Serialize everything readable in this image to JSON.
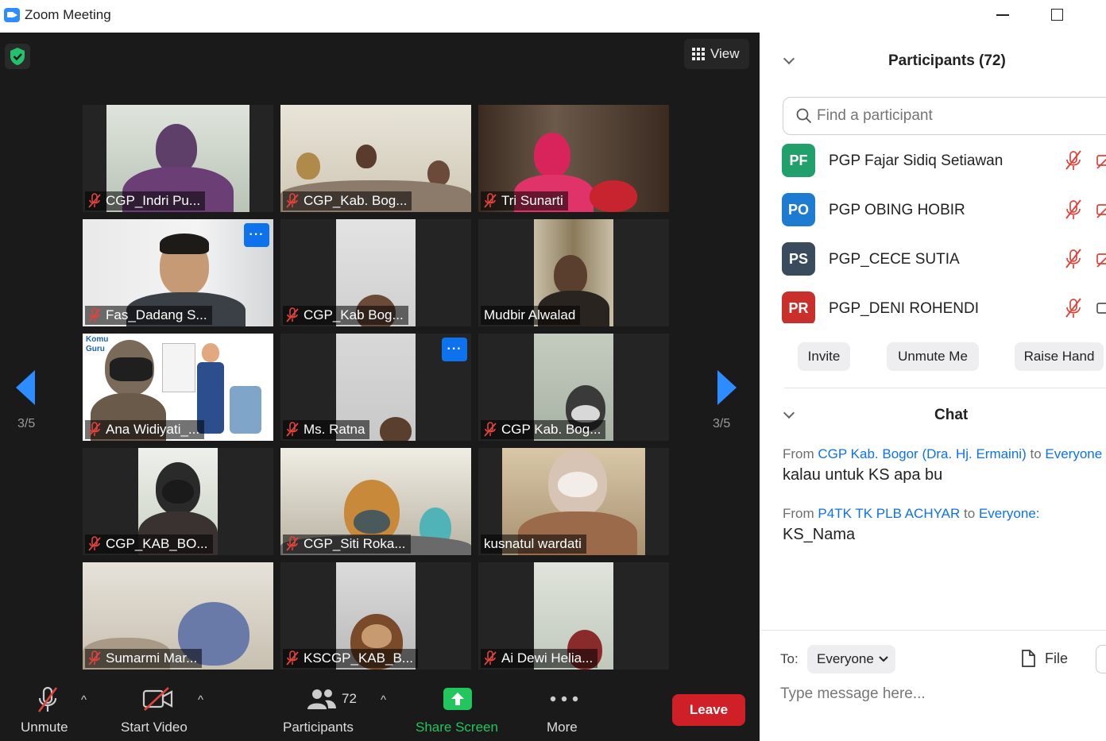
{
  "window": {
    "title": "Zoom Meeting"
  },
  "meeting": {
    "view_label": "View",
    "page_left": "3/5",
    "page_right": "3/5",
    "tiles": [
      {
        "name": "CGP_Indri Pu...",
        "muted": true
      },
      {
        "name": "CGP_Kab. Bog...",
        "muted": true
      },
      {
        "name": "Tri Sunarti",
        "muted": true
      },
      {
        "name": "Fas_Dadang S...",
        "muted": true,
        "menu": "···"
      },
      {
        "name": "CGP_Kab Bog...",
        "muted": true
      },
      {
        "name": "Mudbir Alwalad",
        "muted": false
      },
      {
        "name": "Ana Widiyati_...",
        "muted": true,
        "slide_text": "Komu Guru"
      },
      {
        "name": "Ms. Ratna",
        "muted": true,
        "menu": "···"
      },
      {
        "name": "CGP Kab. Bog...",
        "muted": true
      },
      {
        "name": "CGP_KAB_BO...",
        "muted": true
      },
      {
        "name": "CGP_Siti Roka...",
        "muted": true
      },
      {
        "name": "kusnatul wardati",
        "muted": false
      },
      {
        "name": "Sumarmi Mar...",
        "muted": true
      },
      {
        "name": "KSCGP_KAB_B...",
        "muted": true
      },
      {
        "name": "Ai Dewi Helia...",
        "muted": true
      }
    ]
  },
  "toolbar": {
    "unmute": "Unmute",
    "start_video": "Start Video",
    "participants": "Participants",
    "participants_count": "72",
    "share_screen": "Share Screen",
    "more": "More",
    "leave": "Leave",
    "caret": "^"
  },
  "participants_panel": {
    "title": "Participants (72)",
    "search_placeholder": "Find a participant",
    "list": [
      {
        "initials": "PF",
        "name": "PGP Fajar Sidiq Setiawan",
        "color": "#22a06b"
      },
      {
        "initials": "PO",
        "name": "PGP OBING HOBIR",
        "color": "#1e7bd2"
      },
      {
        "initials": "PS",
        "name": "PGP_CECE SUTIA",
        "color": "#3b4b5e"
      },
      {
        "initials": "PR",
        "name": "PGP_DENI ROHENDI",
        "color": "#c9302c"
      }
    ],
    "invite": "Invite",
    "unmute_me": "Unmute Me",
    "raise_hand": "Raise Hand"
  },
  "chat": {
    "title": "Chat",
    "messages": [
      {
        "from_prefix": "From",
        "sender": "CGP Kab. Bogor (Dra. Hj. Ermaini)",
        "to_word": "to",
        "recipient": "Everyone",
        "text": "kalau untuk KS apa bu"
      },
      {
        "from_prefix": "From",
        "sender": "P4TK TK PLB ACHYAR",
        "to_word": "to",
        "recipient": "Everyone:",
        "text": "KS_Nama"
      }
    ],
    "to_label": "To:",
    "to_value": "Everyone",
    "file_label": "File",
    "input_placeholder": "Type message here..."
  },
  "colors": {
    "accent": "#0e72ed",
    "leave": "#cf2027",
    "share": "#22c55e",
    "muted_red": "#e0433a"
  }
}
